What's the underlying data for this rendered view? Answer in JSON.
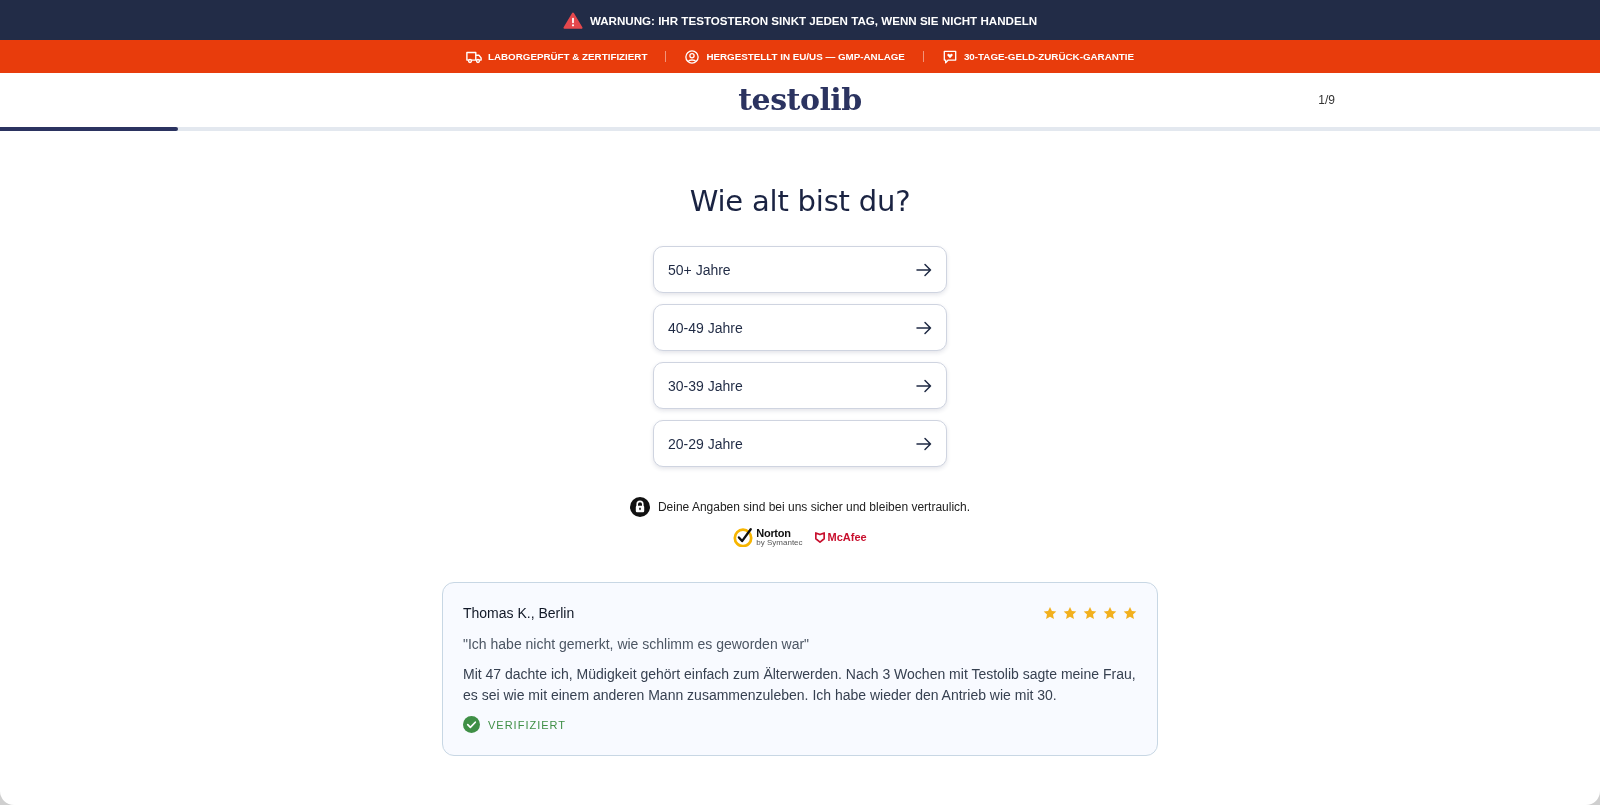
{
  "warning_bar": {
    "text": "WARNUNG: IHR TESTOSTERON SINKT JEDEN TAG, WENN SIE NICHT HANDELN"
  },
  "trust_bar": {
    "items": [
      {
        "kind": "truck",
        "label": "LABORGEPRÜFT & ZERTIFIZIERT"
      },
      {
        "kind": "person",
        "label": "HERGESTELLT IN EU/US — GMP-ANLAGE"
      },
      {
        "kind": "message",
        "label": "30-TAGE-GELD-ZURÜCK-GARANTIE"
      }
    ]
  },
  "header": {
    "logo": "testolib",
    "step": "1/9",
    "progress": {
      "level": 0.111
    }
  },
  "question": {
    "title": "Wie alt bist du?",
    "options": [
      {
        "label": "50+ Jahre"
      },
      {
        "label": "40-49 Jahre"
      },
      {
        "label": "30-39 Jahre"
      },
      {
        "label": "20-29 Jahre"
      }
    ]
  },
  "privacy": {
    "text": "Deine Angaben sind bei uns sicher und bleiben vertraulich.",
    "badges": [
      {
        "kind": "norton",
        "name": "Norton",
        "subtitle": "by Symantec"
      },
      {
        "kind": "mcafee",
        "name": "McAfee"
      }
    ]
  },
  "testimonial": {
    "author": "Thomas K., Berlin",
    "stars": 5,
    "headline": "\"Ich habe nicht gemerkt, wie schlimm es geworden war\"",
    "body": "Mit 47 dachte ich, Müdigkeit gehört einfach zum Älterwerden. Nach 3 Wochen mit Testolib sagte meine Frau, es sei wie mit einem anderen Mann zusammenzuleben. Ich habe wieder den Antrieb wie mit 30.",
    "badge": "VERIFIZIERT"
  }
}
